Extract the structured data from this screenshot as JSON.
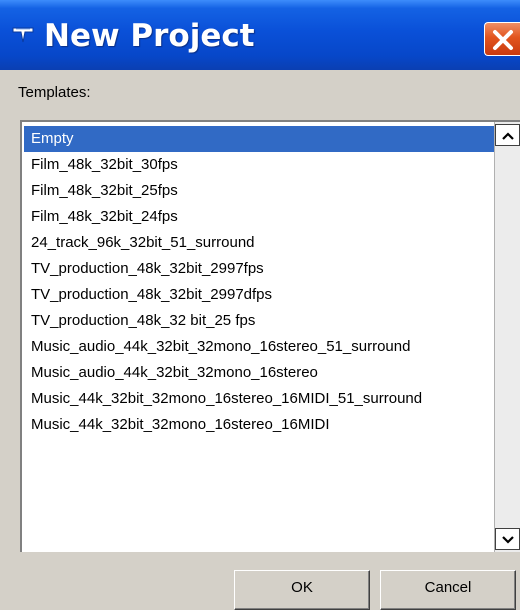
{
  "window": {
    "title": "New Project",
    "app_icon": "cubase-icon",
    "close_icon": "close-icon"
  },
  "templates": {
    "label": "Templates:",
    "selected_index": 0,
    "items": [
      "Empty",
      "Film_48k_32bit_30fps",
      "Film_48k_32bit_25fps",
      "Film_48k_32bit_24fps",
      "24_track_96k_32bit_51_surround",
      "TV_production_48k_32bit_2997fps",
      "TV_production_48k_32bit_2997dfps",
      "TV_production_48k_32 bit_25 fps",
      "Music_audio_44k_32bit_32mono_16stereo_51_surround",
      "Music_audio_44k_32bit_32mono_16stereo",
      "Music_44k_32bit_32mono_16stereo_16MIDI_51_surround",
      "Music_44k_32bit_32mono_16stereo_16MIDI"
    ]
  },
  "scrollbar": {
    "up_icon": "scroll-up-arrow-icon",
    "down_icon": "scroll-down-arrow-icon"
  },
  "buttons": {
    "ok": "OK",
    "cancel": "Cancel"
  },
  "colors": {
    "titlebar": "#0a50d8",
    "selection": "#316ac5",
    "close_button": "#e2551f",
    "dialog_background": "#d4d0c8"
  }
}
